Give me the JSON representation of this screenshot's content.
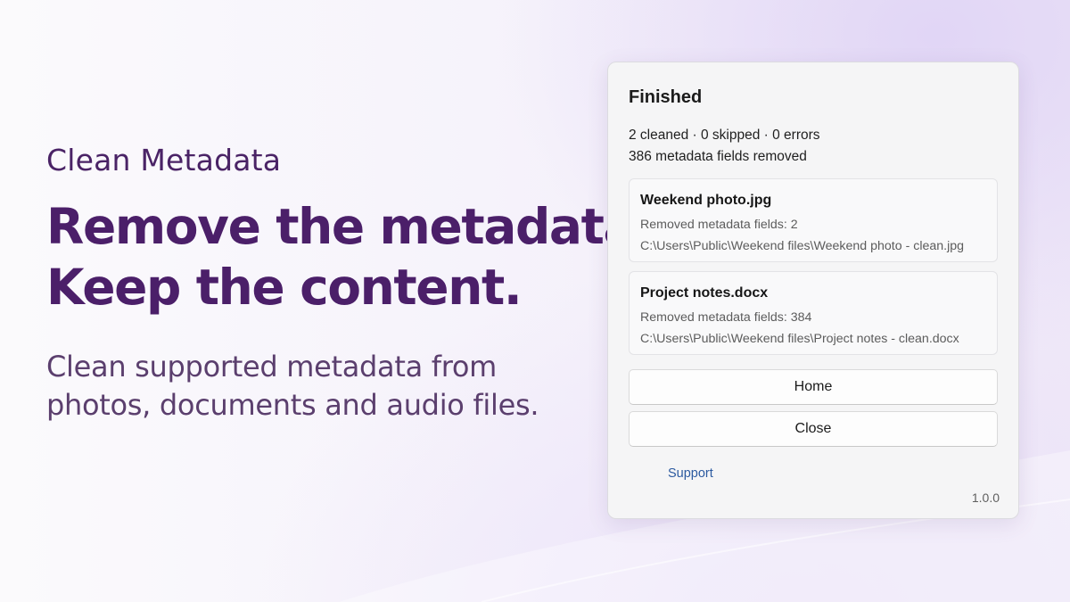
{
  "hero": {
    "brand": "Clean Metadata",
    "headline_line1": "Remove the metadata.",
    "headline_line2": "Keep the content.",
    "subcopy_line1": "Clean supported metadata from",
    "subcopy_line2": "photos, documents and audio files."
  },
  "dialog": {
    "title": "Finished",
    "summary_counts": "2 cleaned · 0 skipped · 0 errors",
    "summary_fields": "386 metadata fields removed",
    "files": [
      {
        "name": "Weekend photo.jpg",
        "removed": "Removed metadata fields: 2",
        "path": "C:\\Users\\Public\\Weekend files\\Weekend photo - clean.jpg"
      },
      {
        "name": "Project notes.docx",
        "removed": "Removed metadata fields: 384",
        "path": "C:\\Users\\Public\\Weekend files\\Project notes - clean.docx"
      }
    ],
    "home_label": "Home",
    "close_label": "Close",
    "support_label": "Support",
    "version": "1.0.0"
  },
  "colors": {
    "brand_purple": "#4b1f69",
    "link_blue": "#2c5aa0"
  }
}
